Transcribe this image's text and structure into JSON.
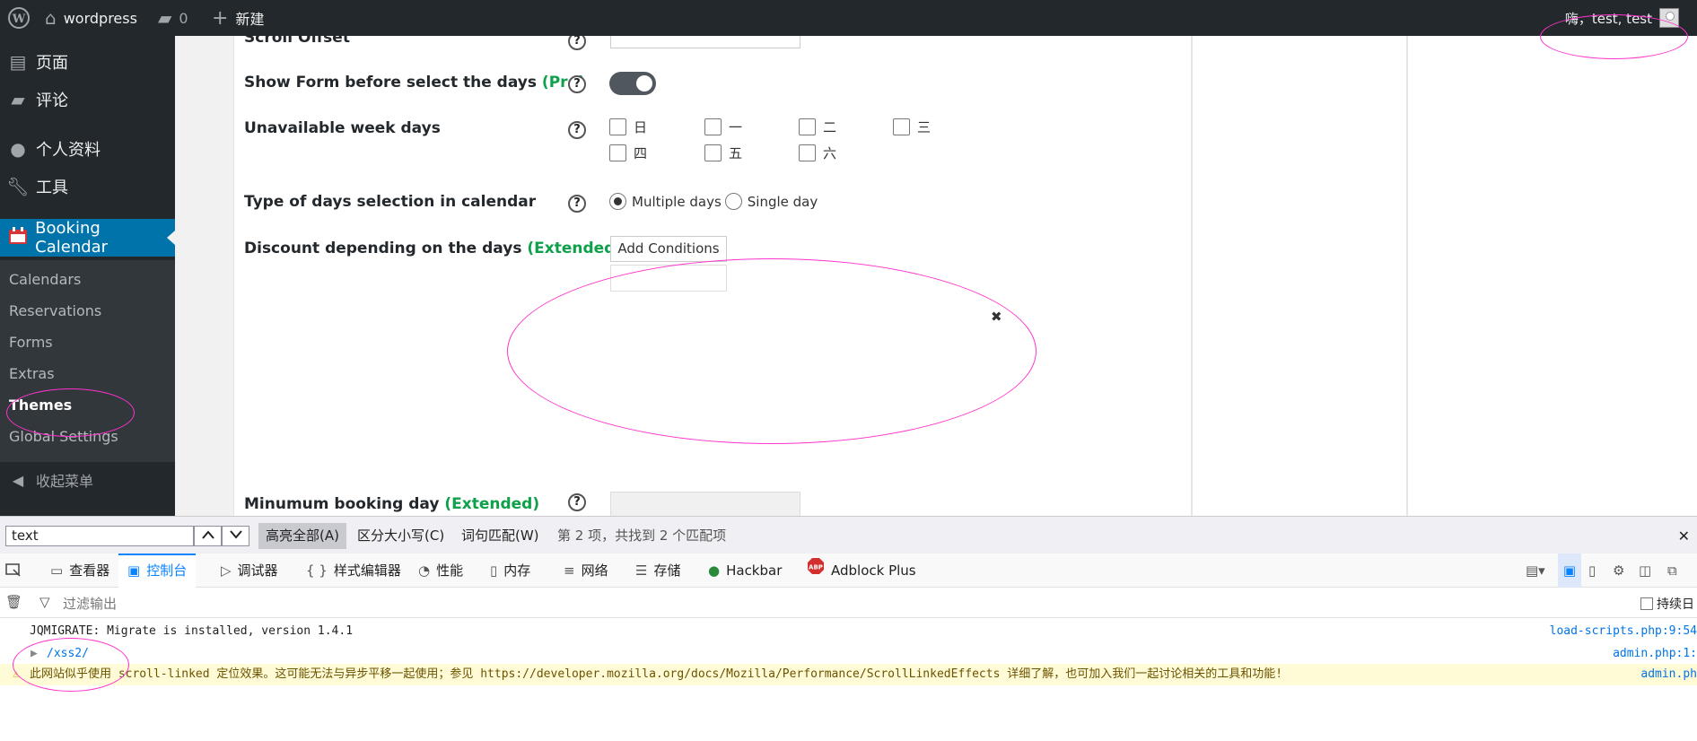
{
  "admin_bar": {
    "site_name": "wordpress",
    "comments_count": "0",
    "new_label": "新建",
    "greeting": "嗨，test, test"
  },
  "sidebar": {
    "items": [
      {
        "label": "页面",
        "icon": "pages-icon"
      },
      {
        "label": "评论",
        "icon": "comment-icon"
      },
      {
        "label": "个人资料",
        "icon": "user-icon"
      },
      {
        "label": "工具",
        "icon": "wrench-icon"
      }
    ],
    "active": {
      "label": "Booking Calendar",
      "icon": "calendar-icon"
    },
    "submenu": [
      "Calendars",
      "Reservations",
      "Forms",
      "Extras",
      "Themes",
      "Global Settings"
    ],
    "current_submenu": "Themes",
    "collapse_label": "收起菜单"
  },
  "settings": {
    "scroll_offset_label": "Scroll Offset",
    "show_form": {
      "label": "Show Form before select the days",
      "tag": "(Pro)",
      "enabled": true
    },
    "unavailable_week_days": {
      "label": "Unavailable week days",
      "days": [
        "日",
        "一",
        "二",
        "三",
        "四",
        "五",
        "六"
      ]
    },
    "days_selection": {
      "label": "Type of days selection in calendar",
      "options": [
        "Multiple days",
        "Single day"
      ],
      "selected": "Multiple days"
    },
    "discount": {
      "label": "Discount depending on the days",
      "tag": "(Extended)",
      "button": "Add Conditions"
    },
    "min_booking": {
      "label": "Minumum booking day",
      "tag": "(Extended)"
    },
    "help_glyph": "?",
    "close_glyph": "✖"
  },
  "findbar": {
    "query": "text",
    "highlight_all": "高亮全部(A)",
    "match_case": "区分大小写(C)",
    "whole_words": "词句匹配(W)",
    "status": "第 2 项，共找到 2 个匹配项",
    "close_glyph": "✕"
  },
  "devtools": {
    "tabs": [
      {
        "label": "查看器",
        "icon": "inspector-icon"
      },
      {
        "label": "控制台",
        "icon": "console-icon"
      },
      {
        "label": "调试器",
        "icon": "debugger-icon"
      },
      {
        "label": "样式编辑器",
        "icon": "style-editor-icon"
      },
      {
        "label": "性能",
        "icon": "performance-icon"
      },
      {
        "label": "内存",
        "icon": "memory-icon"
      },
      {
        "label": "网络",
        "icon": "network-icon"
      },
      {
        "label": "存储",
        "icon": "storage-icon"
      },
      {
        "label": "Hackbar",
        "icon": "hackbar-icon"
      },
      {
        "label": "Adblock Plus",
        "icon": "abp-icon"
      }
    ],
    "selected_tab": "控制台",
    "filter_placeholder": "过滤输出",
    "persist_label": "持续日",
    "logs": [
      {
        "text": "JQMIGRATE: Migrate is installed, version 1.4.1",
        "source": "load-scripts.php:9:54",
        "type": "log"
      },
      {
        "text": "/xss2/",
        "source": "admin.php:1:",
        "type": "object"
      },
      {
        "text": "此网站似乎使用 scroll-linked 定位效果。这可能无法与异步平移一起使用；参见 https://developer.mozilla.org/docs/Mozilla/Performance/ScrollLinkedEffects 详细了解，也可加入我们一起讨论相关的工具和功能!",
        "source": "admin.ph",
        "type": "warning"
      }
    ]
  },
  "colors": {
    "admin_bar": "#23282d",
    "sidebar_sub": "#32373c",
    "active": "#0073aa",
    "tag_green": "#0ea04a",
    "annotation": "#ff33cc"
  }
}
